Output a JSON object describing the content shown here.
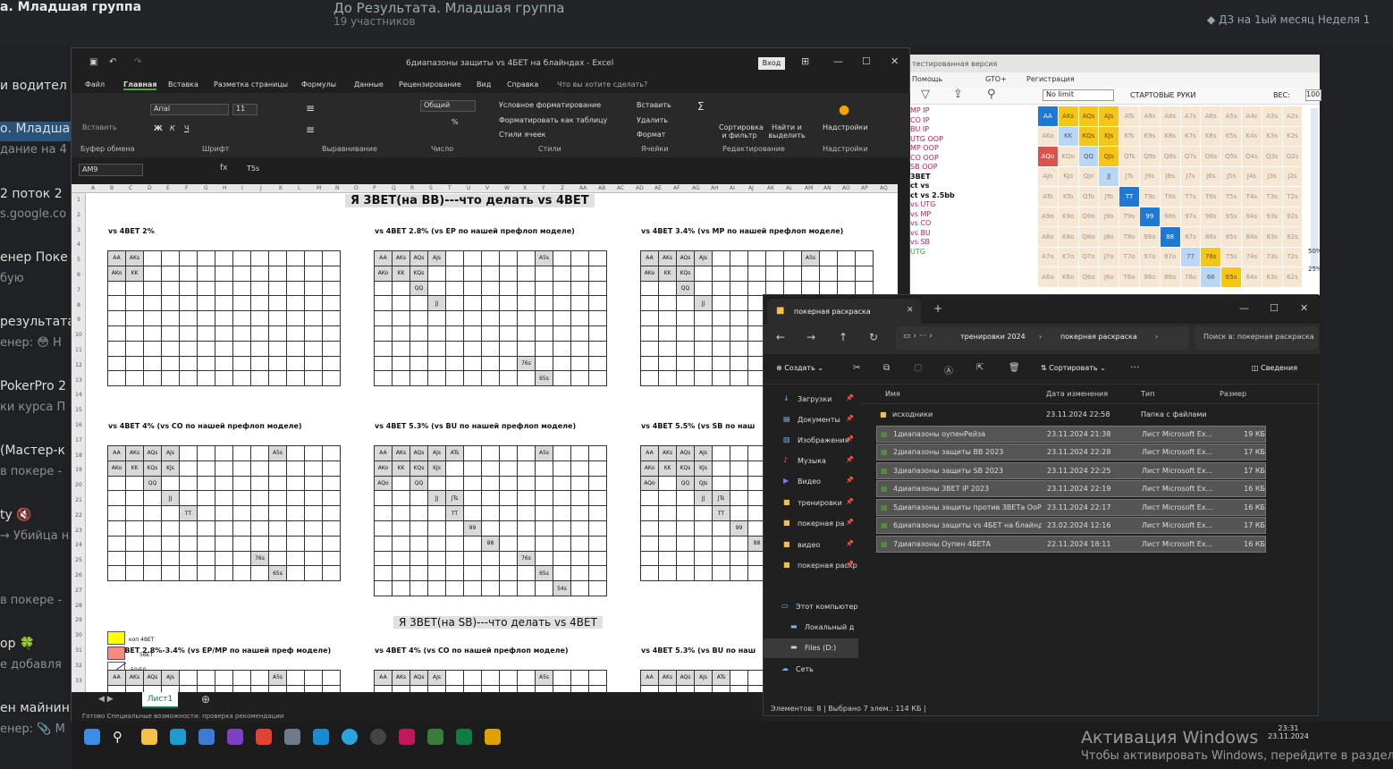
{
  "telegram": {
    "title": "а. Младшая группа",
    "group_name": "До Результата. Младшая группа",
    "members": "19 участников",
    "pinned": "◆ ДЗ на 1ый месяц Неделя 1",
    "chats": [
      {
        "name": "и водител",
        "sub": ""
      },
      {
        "name": "о. Младша",
        "sub": "дание на 4"
      },
      {
        "name": "2 поток 2",
        "sub": "s.google.co"
      },
      {
        "name": "енер Поке",
        "sub": "бую"
      },
      {
        "name": "результата",
        "sub": "енер: 😳 Н"
      },
      {
        "name": "PokerPro 2",
        "sub": "ки курса П"
      },
      {
        "name": "(Мастер-к",
        "sub": "в покере -"
      },
      {
        "name": "ty 🔇",
        "sub": "→ Убийца н"
      },
      {
        "name": "в покере -",
        "sub": ""
      },
      {
        "name": "ор 🍀",
        "sub": "е добавля"
      },
      {
        "name": "ен майнинг",
        "sub": "енер: 📎 М"
      }
    ]
  },
  "excel": {
    "window_title": "6диапазоны защиты vs 4БЕТ на блайндах  -  Excel",
    "sign_in": "Вход",
    "menu": [
      "Файл",
      "Главная",
      "Вставка",
      "Разметка страницы",
      "Формулы",
      "Данные",
      "Рецензирование",
      "Вид",
      "Справка",
      "Что вы хотите сделать?"
    ],
    "ribbon": {
      "paste": "Вставить",
      "clipboard": "Буфер обмена",
      "font_name": "Arial",
      "font_size": "11",
      "font_group": "Шрифт",
      "align_group": "Выравнивание",
      "number_format": "Общий",
      "number_group": "Число",
      "cond_format": "Условное форматирование",
      "format_table": "Форматировать как таблицу",
      "cell_styles": "Стили ячеек",
      "styles_group": "Стили",
      "insert": "Вставить",
      "delete": "Удалить",
      "format": "Формат",
      "cells_group": "Ячейки",
      "sort": "Сортировка и фильтр",
      "find": "Найти и выделить",
      "edit_group": "Редактирование",
      "addins": "Надстройки",
      "addins_group": "Надстройки"
    },
    "name_box": "AM9",
    "formula": "T5s",
    "columns": [
      "A",
      "B",
      "C",
      "D",
      "E",
      "F",
      "G",
      "H",
      "I",
      "J",
      "K",
      "L",
      "M",
      "N",
      "O",
      "P",
      "Q",
      "R",
      "S",
      "T",
      "U",
      "V",
      "W",
      "X",
      "Y",
      "Z",
      "AA",
      "AB",
      "AC",
      "AD",
      "AE",
      "AF",
      "AG",
      "AH",
      "AI",
      "AJ",
      "AK",
      "AL",
      "AM",
      "AN",
      "AO",
      "AP",
      "AQ"
    ],
    "rows": [
      "1",
      "2",
      "3",
      "4",
      "5",
      "6",
      "7",
      "8",
      "9",
      "10",
      "11",
      "12",
      "13",
      "14",
      "15",
      "16",
      "17",
      "18",
      "19",
      "20",
      "21",
      "22",
      "23",
      "24",
      "25",
      "26",
      "27",
      "28",
      "29",
      "30",
      "31",
      "32",
      "33"
    ],
    "title_bb": "Я 3BET(на BB)---что делать vs 4BET",
    "title_sb": "Я 3BET(на SB)---что делать vs 4BET",
    "blocks": {
      "b1": "vs 4BET 2%",
      "b2": "vs 4BET 2.8%     (vs EP по нашей префлоп моделе)",
      "b3": "vs 4BET 3.4%     (vs MP по нашей префлоп моделе)",
      "b4": "vs 4BET 4%     (vs CO по нашей префлоп моделе)",
      "b5": "vs 4BET 5.3%     (vs BU по нашей префлоп моделе)",
      "b6": "vs 4BET 5.5%     (vs SB по наш",
      "b7": "vs 4BET 2.8%-3.4%     (vs EP/MP по нашей преф моделе)",
      "b8": "vs 4BET 4%     (vs CO по нашей префлоп моделе)",
      "b9": "vs 4BET 5.3%     (vs BU по наш"
    },
    "legend": {
      "l1": "коп 4BET",
      "l2": "5BET",
      "l3": "50/50"
    },
    "sheet_tab": "Лист1",
    "status": "Готово     Специальные возможности: проверка рекомендации"
  },
  "poker": {
    "trial": "тестированная версия",
    "menu": [
      "Помощь",
      "GTO+",
      "Регистрация"
    ],
    "limit": "No limit",
    "starting_hands": "СТАРТОВЫЕ РУКИ",
    "weight": "ВЕС:",
    "weight_value": "100",
    "list": [
      "MP IP",
      "CO IP",
      "BU IP",
      "UTG OOP",
      "MP OOP",
      "CO OOP",
      "SB OOP",
      "3BET",
      "ct vs",
      "ct vs 2.5bb",
      "vs UTG",
      "vs MP",
      "vs CO",
      "vs BU",
      "vs SB",
      "UTG"
    ],
    "grid": [
      [
        "AA",
        "AKs",
        "AQs",
        "AJs",
        "ATs",
        "A9s",
        "A8s",
        "A7s",
        "A6s",
        "A5s",
        "A4s",
        "A3s",
        "A2s"
      ],
      [
        "AKo",
        "KK",
        "KQs",
        "KJs",
        "KTs",
        "K9s",
        "K8s",
        "K7s",
        "K6s",
        "K5s",
        "K4s",
        "K3s",
        "K2s"
      ],
      [
        "AQo",
        "KQo",
        "QQ",
        "QJs",
        "QTs",
        "Q9s",
        "Q8s",
        "Q7s",
        "Q6s",
        "Q5s",
        "Q4s",
        "Q3s",
        "Q2s"
      ],
      [
        "AJo",
        "KJo",
        "QJo",
        "JJ",
        "JTs",
        "J9s",
        "J8s",
        "J7s",
        "J6s",
        "J5s",
        "J4s",
        "J3s",
        "J2s"
      ],
      [
        "ATo",
        "KTo",
        "QTo",
        "JTo",
        "TT",
        "T9s",
        "T8s",
        "T7s",
        "T6s",
        "T5s",
        "T4s",
        "T3s",
        "T2s"
      ],
      [
        "A9o",
        "K9o",
        "Q9o",
        "J9o",
        "T9o",
        "99",
        "98s",
        "97s",
        "96s",
        "95s",
        "94s",
        "93s",
        "92s"
      ],
      [
        "A8o",
        "K8o",
        "Q8o",
        "J8o",
        "T8o",
        "98o",
        "88",
        "87s",
        "86s",
        "85s",
        "84s",
        "83s",
        "82s"
      ],
      [
        "A7o",
        "K7o",
        "Q7o",
        "J7o",
        "T7o",
        "97o",
        "87o",
        "77",
        "76s",
        "75s",
        "74s",
        "73s",
        "72s"
      ],
      [
        "A6o",
        "K6o",
        "Q6o",
        "J6o",
        "T6o",
        "96o",
        "86o",
        "76o",
        "66",
        "65s",
        "64s",
        "63s",
        "62s"
      ]
    ],
    "side_pct": [
      "50%",
      "25%"
    ]
  },
  "explorer": {
    "tab_title": "покерная раскраска",
    "breadcrumb": [
      "тренировки 2024",
      "покерная раскраска"
    ],
    "search_placeholder": "Поиск в: покерная раскраска",
    "create": "Создать",
    "sort": "Сортировать",
    "details": "Сведения",
    "sidebar": [
      "Загрузки",
      "Документы",
      "Изображения",
      "Музыка",
      "Видео",
      "тренировки",
      "покерная ра",
      "видео",
      "покерная раскр",
      "Этот компьютер",
      "Локальный д",
      "Files (D:)",
      "Сеть"
    ],
    "headers": [
      "Имя",
      "Дата изменения",
      "Тип",
      "Размер"
    ],
    "files": [
      {
        "name": "исходники",
        "date": "23.11.2024 22:58",
        "type": "Папка с файлами",
        "size": ""
      },
      {
        "name": "1диапазоны оупенРейза",
        "date": "23.11.2024 21:38",
        "type": "Лист Microsoft Ex...",
        "size": "19 КБ"
      },
      {
        "name": "2диапазоны защиты  BB 2023",
        "date": "23.11.2024 22:28",
        "type": "Лист Microsoft Ex...",
        "size": "17 КБ"
      },
      {
        "name": "3диапазоны защиты  SB 2023",
        "date": "23.11.2024 22:25",
        "type": "Лист Microsoft Ex...",
        "size": "17 КБ"
      },
      {
        "name": "4диапазоны 3BET iP 2023",
        "date": "23.11.2024 22:19",
        "type": "Лист Microsoft Ex...",
        "size": "16 КБ"
      },
      {
        "name": "5диапазоны защиты против 3BETа OoP",
        "date": "23.11.2024 22:17",
        "type": "Лист Microsoft Ex...",
        "size": "16 КБ"
      },
      {
        "name": "6диапазоны защиты vs 4БЕТ на блайндах",
        "date": "23.02.2024 12:16",
        "type": "Лист Microsoft Ex...",
        "size": "17 КБ"
      },
      {
        "name": "7диапазоны Оупен 4БЕТА",
        "date": "22.11.2024 18:11",
        "type": "Лист Microsoft Ex...",
        "size": "16 КБ"
      }
    ],
    "status": "Элементов: 8   |   Выбрано 7 элем.: 114 КБ   |"
  },
  "taskbar": {
    "time": "23:31",
    "date": "23.11.2024",
    "activation_title": "Активация Windows",
    "activation_text": "Чтобы активировать Windows, перейдите в раздел"
  }
}
